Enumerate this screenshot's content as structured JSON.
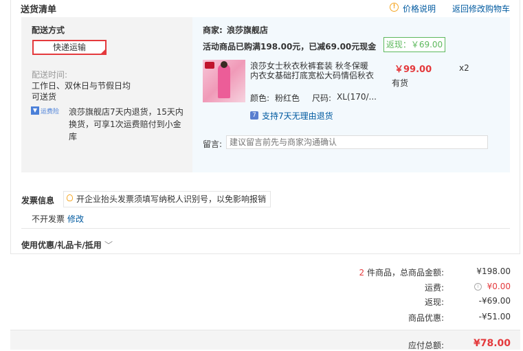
{
  "header": {
    "title": "送货清单",
    "price_note": "价格说明",
    "back_to_cart": "返回修改购物车"
  },
  "shipping": {
    "label": "配送方式",
    "method": "快递运输",
    "time_label": "配送时间:",
    "time_value": "工作日、双休日与节假日均",
    "time_value2": "可送货",
    "freight_icon_label": "运费险",
    "policy": "浪莎旗舰店7天内退货，15天内",
    "policy2": "换货，可享1次运费赔付到小金",
    "policy3": "库"
  },
  "merchant": {
    "label": "商家:",
    "name": "浪莎旗舰店",
    "promo": "活动商品已购满198.00元，已减69.00元现金",
    "rebate": "返现：￥69.00",
    "product_name": "浪莎女士秋衣秋裤套装 秋冬保暖",
    "product_name2": "内衣女基础打底宽松大码情侣秋衣",
    "price": "￥99.00",
    "qty": "x2",
    "stock": "有货",
    "color_label": "颜色:",
    "color_value": "粉红色",
    "size_label": "尺码:",
    "size_value": "XL(170/...",
    "return_policy": "支持7天无理由退货",
    "message_label": "留言:",
    "message_placeholder": "建议留言前先与商家沟通确认"
  },
  "invoice": {
    "label": "发票信息",
    "tip": "开企业抬头发票须填写纳税人识别号，以免影响报销",
    "value": "不开发票",
    "edit": "修改"
  },
  "coupon": {
    "label": "使用优惠/礼品卡/抵用"
  },
  "summary": {
    "count": "2",
    "count_label": "件商品，总商品金额:",
    "goods_total": "¥198.00",
    "freight_label": "运费:",
    "freight": "¥0.00",
    "rebate_label": "返现:",
    "rebate": "-¥69.00",
    "discount_label": "商品优惠:",
    "discount": "-¥51.00",
    "payable_label": "应付总额:",
    "payable": "¥78.00"
  }
}
